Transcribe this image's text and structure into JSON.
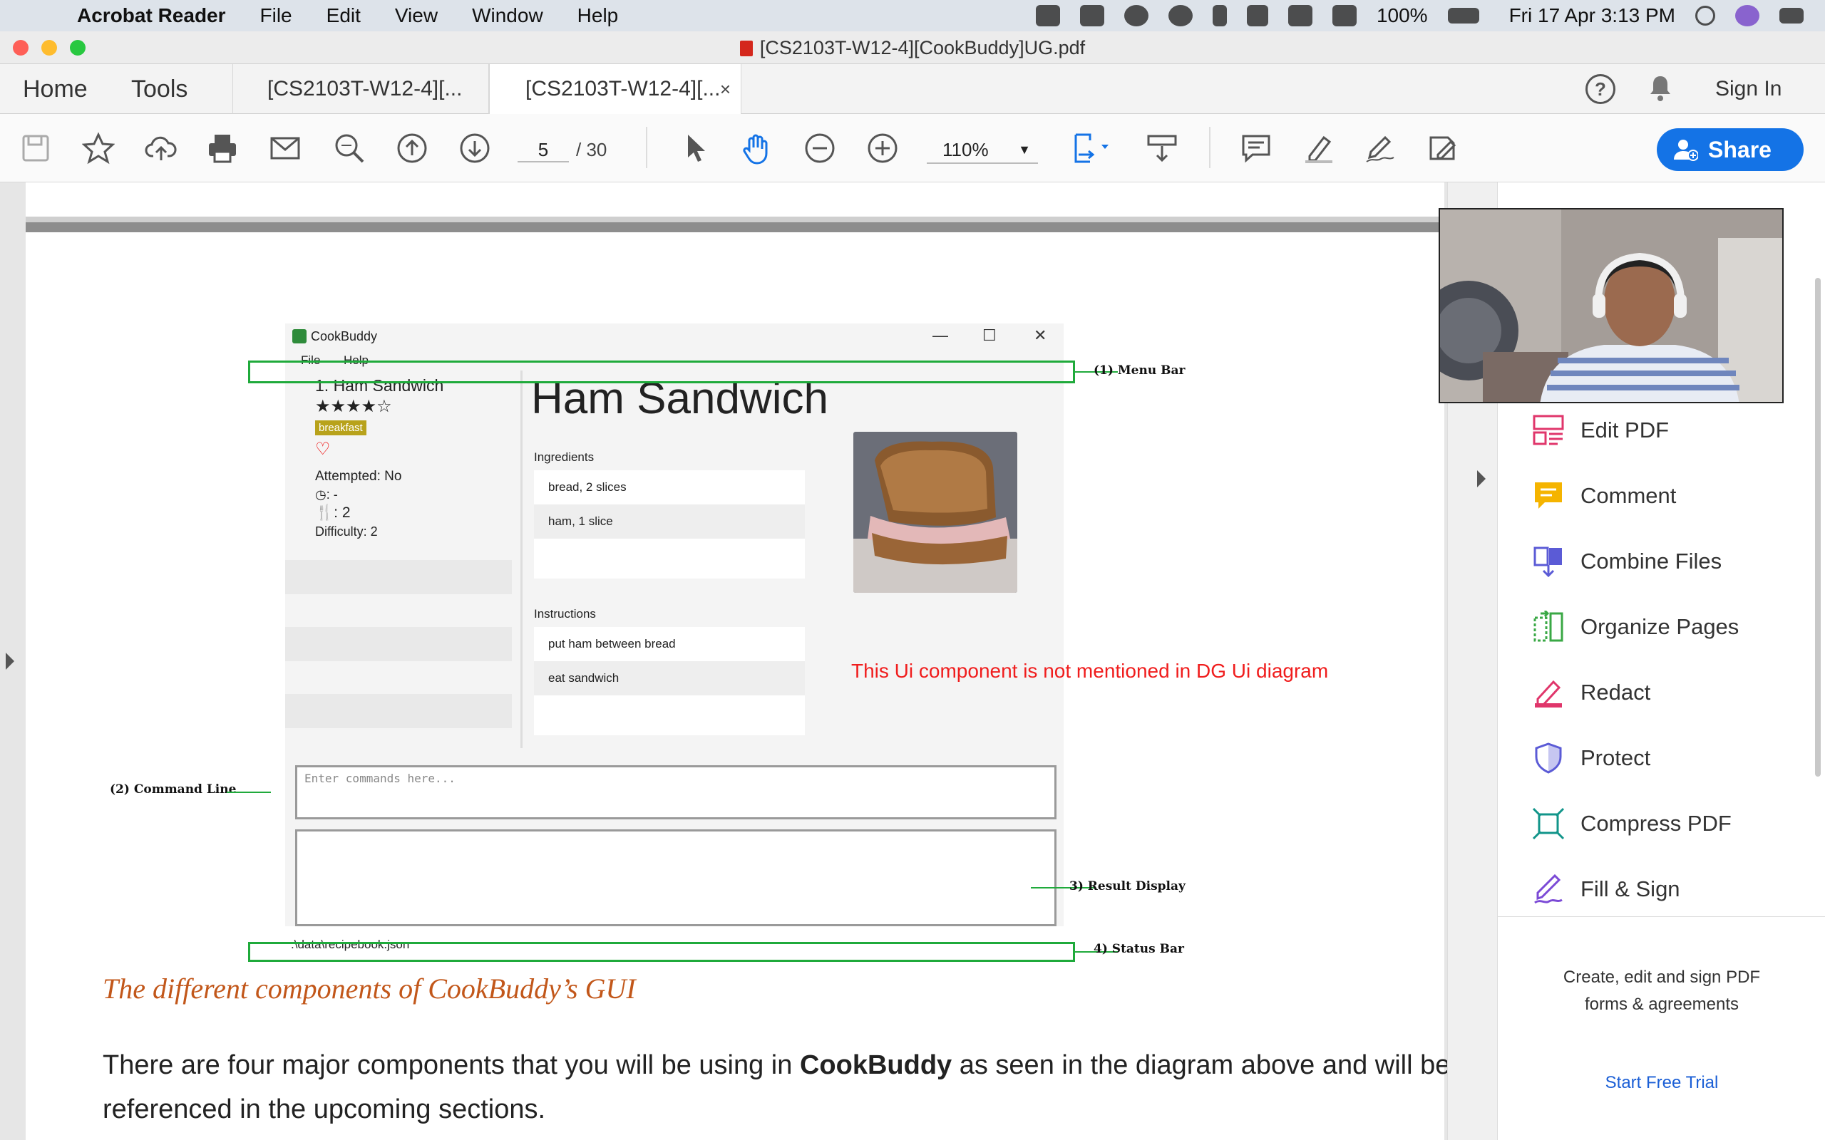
{
  "menubar": {
    "app_name": "Acrobat Reader",
    "menus": [
      "File",
      "Edit",
      "View",
      "Window",
      "Help"
    ],
    "battery": "100%",
    "datetime": "Fri 17 Apr  3:13 PM"
  },
  "window": {
    "title": "[CS2103T-W12-4][CookBuddy]UG.pdf"
  },
  "tabs": {
    "home": "Home",
    "tools": "Tools",
    "doc_tab_1": "[CS2103T-W12-4][...",
    "doc_tab_2": "[CS2103T-W12-4][...",
    "close": "×",
    "sign_in": "Sign In"
  },
  "toolbar": {
    "page_current": "5",
    "page_total": "/  30",
    "zoom": "110%",
    "share_label": "Share"
  },
  "figure": {
    "app_title": "CookBuddy",
    "menu_items": [
      "File",
      "Help"
    ],
    "recipe_index": "1.  Ham Sandwich",
    "stars": "★★★★☆",
    "tag": "breakfast",
    "attempted": "Attempted: No",
    "time": ": -",
    "servings": ": 2",
    "difficulty": "Difficulty: 2",
    "recipe_title": "Ham Sandwich",
    "ingredients_label": "Ingredients",
    "ingredients": [
      "bread, 2 slices",
      "ham, 1 slice"
    ],
    "instructions_label": "Instructions",
    "instructions": [
      "put ham between bread",
      "eat sandwich"
    ],
    "command_placeholder": "Enter commands here...",
    "status_path": ".\\data\\recipebook.json",
    "annotations": {
      "menu_bar": "(1) Menu Bar",
      "command_line": "(2) Command Line",
      "result_display": "3) Result Display",
      "status_bar": "4) Status Bar"
    },
    "red_note": "This Ui component is not mentioned in DG Ui diagram"
  },
  "document": {
    "caption": "The different components of CookBuddy’s GUI",
    "para_pre": "There are four major components that you will be using in ",
    "para_bold": "CookBuddy",
    "para_post": " as seen in the diagram above and will be referenced in the upcoming sections."
  },
  "tools_panel": {
    "items": [
      "Edit PDF",
      "Comment",
      "Combine Files",
      "Organize Pages",
      "Redact",
      "Protect",
      "Compress PDF",
      "Fill & Sign"
    ],
    "promo_line1": "Create, edit and sign PDF",
    "promo_line2": "forms & agreements",
    "trial": "Start Free Trial"
  },
  "colors": {
    "accent": "#1473e6",
    "annotation_green": "#1faa3b",
    "caption_orange": "#c2571a",
    "note_red": "#f01d1d"
  }
}
